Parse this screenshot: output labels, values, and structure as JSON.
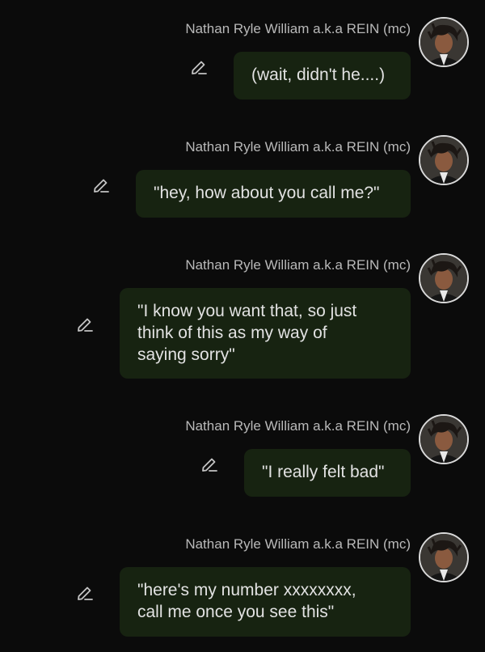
{
  "colors": {
    "background": "#0b0b0b",
    "bubble": "#172311",
    "bubble_text": "#e2e2e2",
    "sender_text": "#b9b9b9"
  },
  "messages": [
    {
      "sender": "Nathan Ryle William a.k.a REIN (mc)",
      "text": "(wait, didn't he....)",
      "icon": "edit-pencil-icon"
    },
    {
      "sender": "Nathan Ryle William a.k.a REIN (mc)",
      "text": "\"hey, how about you call me?\"",
      "icon": "edit-pencil-icon"
    },
    {
      "sender": "Nathan Ryle William a.k.a REIN (mc)",
      "text": "\"I know you want that, so just think of this as my way of saying sorry\"",
      "icon": "edit-pencil-icon"
    },
    {
      "sender": "Nathan Ryle William a.k.a REIN (mc)",
      "text": "\"I really felt bad\"",
      "icon": "edit-pencil-icon"
    },
    {
      "sender": "Nathan Ryle William a.k.a REIN (mc)",
      "text": "\"here's my number xxxxxxxx, call me once you see this\"",
      "icon": "edit-pencil-icon"
    }
  ]
}
